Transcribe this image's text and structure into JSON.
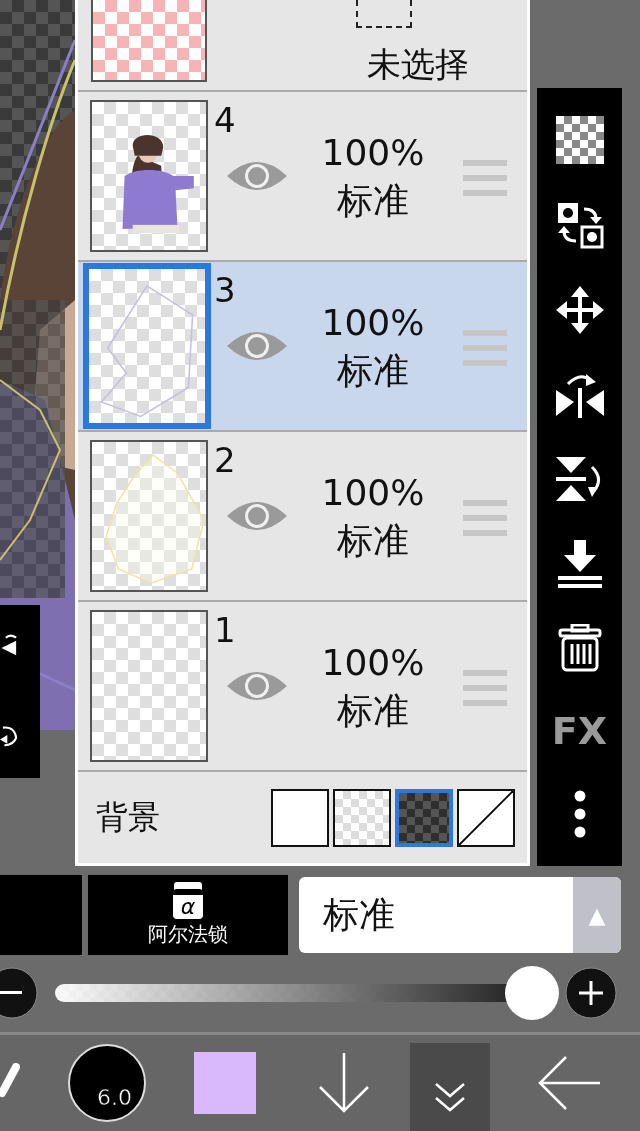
{
  "top_layer": {
    "label": "未选择"
  },
  "layers": [
    {
      "number": "4",
      "opacity": "100%",
      "blend": "标准",
      "visible": true,
      "selected": false,
      "kind": "picture"
    },
    {
      "number": "3",
      "opacity": "100%",
      "blend": "标准",
      "visible": true,
      "selected": true,
      "kind": "purple-outline"
    },
    {
      "number": "2",
      "opacity": "100%",
      "blend": "标准",
      "visible": true,
      "selected": false,
      "kind": "yellow-outline"
    },
    {
      "number": "1",
      "opacity": "100%",
      "blend": "标准",
      "visible": true,
      "selected": false,
      "kind": "empty"
    }
  ],
  "background": {
    "label": "背景",
    "swatches": [
      {
        "kind": "white",
        "selected": false
      },
      {
        "kind": "checker",
        "selected": false
      },
      {
        "kind": "dark-checker",
        "selected": true
      },
      {
        "kind": "none",
        "selected": false
      }
    ]
  },
  "side_tools": [
    {
      "kind": "checker"
    },
    {
      "kind": "swap"
    },
    {
      "kind": "move"
    },
    {
      "kind": "flip-h"
    },
    {
      "kind": "flip-v"
    },
    {
      "kind": "merge-down"
    },
    {
      "kind": "delete"
    },
    {
      "kind": "fx",
      "label": "FX"
    },
    {
      "kind": "more"
    }
  ],
  "alpha_lock": {
    "symbol": "α",
    "label": "阿尔法锁"
  },
  "blend_mode": {
    "value": "标准",
    "arrow": "▲"
  },
  "opacity_slider": {
    "level": 0.95
  },
  "toolbar": {
    "brush_size": "6.0",
    "color": "#d9b8fc"
  }
}
